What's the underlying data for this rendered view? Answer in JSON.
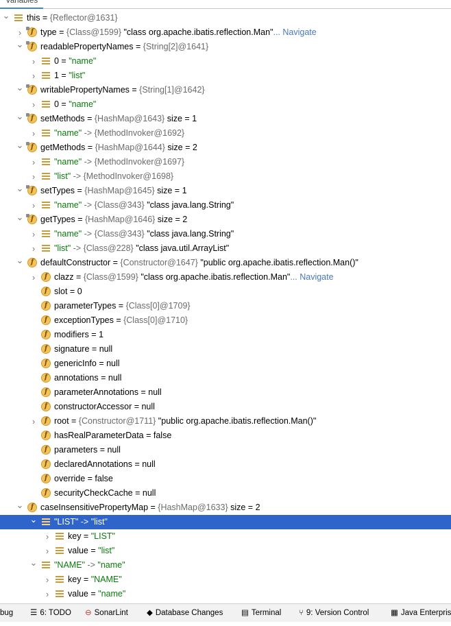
{
  "header": {
    "tab": "Variables"
  },
  "tree": [
    {
      "indent": 0,
      "expander": "down",
      "icon": "list",
      "name": "this",
      "value": "{Reflector@1631}",
      "extra": "",
      "link": "",
      "selected": false
    },
    {
      "indent": 1,
      "expander": "right",
      "icon": "field-static",
      "name": "type",
      "value": "{Class@1599}",
      "extra": "\"class org.apache.ibatis.reflection.Man\"",
      "link": "... Navigate",
      "selected": false
    },
    {
      "indent": 1,
      "expander": "down",
      "icon": "field-static",
      "name": "readablePropertyNames",
      "value": "{String[2]@1641}",
      "extra": "",
      "link": "",
      "selected": false
    },
    {
      "indent": 2,
      "expander": "right",
      "icon": "list",
      "name": "0",
      "value": "\"name\"",
      "extra": "",
      "link": "",
      "selected": false
    },
    {
      "indent": 2,
      "expander": "right",
      "icon": "list",
      "name": "1",
      "value": "\"list\"",
      "extra": "",
      "link": "",
      "selected": false
    },
    {
      "indent": 1,
      "expander": "down",
      "icon": "field-static",
      "name": "writablePropertyNames",
      "value": "{String[1]@1642}",
      "extra": "",
      "link": "",
      "selected": false
    },
    {
      "indent": 2,
      "expander": "right",
      "icon": "list",
      "name": "0",
      "value": "\"name\"",
      "extra": "",
      "link": "",
      "selected": false
    },
    {
      "indent": 1,
      "expander": "down",
      "icon": "field-static",
      "name": "setMethods",
      "value": "{HashMap@1643}",
      "extra": " size = 1",
      "link": "",
      "selected": false
    },
    {
      "indent": 2,
      "expander": "right",
      "icon": "list",
      "name": "\"name\"",
      "value": "-> {MethodInvoker@1692}",
      "extra": "",
      "link": "",
      "selected": false
    },
    {
      "indent": 1,
      "expander": "down",
      "icon": "field-static",
      "name": "getMethods",
      "value": "{HashMap@1644}",
      "extra": " size = 2",
      "link": "",
      "selected": false
    },
    {
      "indent": 2,
      "expander": "right",
      "icon": "list",
      "name": "\"name\"",
      "value": "-> {MethodInvoker@1697}",
      "extra": "",
      "link": "",
      "selected": false
    },
    {
      "indent": 2,
      "expander": "right",
      "icon": "list",
      "name": "\"list\"",
      "value": "-> {MethodInvoker@1698}",
      "extra": "",
      "link": "",
      "selected": false
    },
    {
      "indent": 1,
      "expander": "down",
      "icon": "field-static",
      "name": "setTypes",
      "value": "{HashMap@1645}",
      "extra": " size = 1",
      "link": "",
      "selected": false
    },
    {
      "indent": 2,
      "expander": "right",
      "icon": "list",
      "name": "\"name\"",
      "value": "-> {Class@343}",
      "extra": "\"class java.lang.String\"",
      "link": "",
      "selected": false
    },
    {
      "indent": 1,
      "expander": "down",
      "icon": "field-static",
      "name": "getTypes",
      "value": "{HashMap@1646}",
      "extra": " size = 2",
      "link": "",
      "selected": false
    },
    {
      "indent": 2,
      "expander": "right",
      "icon": "list",
      "name": "\"name\"",
      "value": "-> {Class@343}",
      "extra": "\"class java.lang.String\"",
      "link": "",
      "selected": false
    },
    {
      "indent": 2,
      "expander": "right",
      "icon": "list",
      "name": "\"list\"",
      "value": "-> {Class@228}",
      "extra": "\"class java.util.ArrayList\"",
      "link": "",
      "selected": false
    },
    {
      "indent": 1,
      "expander": "down",
      "icon": "field",
      "name": "defaultConstructor",
      "value": "{Constructor@1647}",
      "extra": "\"public org.apache.ibatis.reflection.Man()\"",
      "link": "",
      "selected": false
    },
    {
      "indent": 2,
      "expander": "right",
      "icon": "field",
      "name": "clazz",
      "value": "{Class@1599}",
      "extra": "\"class org.apache.ibatis.reflection.Man\"",
      "link": "... Navigate",
      "selected": false
    },
    {
      "indent": 2,
      "expander": "none",
      "icon": "field",
      "name": "slot",
      "value": "0",
      "extra": "",
      "link": "",
      "selected": false
    },
    {
      "indent": 2,
      "expander": "none",
      "icon": "field",
      "name": "parameterTypes",
      "value": "{Class[0]@1709}",
      "extra": "",
      "link": "",
      "selected": false
    },
    {
      "indent": 2,
      "expander": "none",
      "icon": "field",
      "name": "exceptionTypes",
      "value": "{Class[0]@1710}",
      "extra": "",
      "link": "",
      "selected": false
    },
    {
      "indent": 2,
      "expander": "none",
      "icon": "field",
      "name": "modifiers",
      "value": "1",
      "extra": "",
      "link": "",
      "selected": false
    },
    {
      "indent": 2,
      "expander": "none",
      "icon": "field",
      "name": "signature",
      "value": "null",
      "extra": "",
      "link": "",
      "selected": false
    },
    {
      "indent": 2,
      "expander": "none",
      "icon": "field",
      "name": "genericInfo",
      "value": "null",
      "extra": "",
      "link": "",
      "selected": false
    },
    {
      "indent": 2,
      "expander": "none",
      "icon": "field",
      "name": "annotations",
      "value": "null",
      "extra": "",
      "link": "",
      "selected": false
    },
    {
      "indent": 2,
      "expander": "none",
      "icon": "field",
      "name": "parameterAnnotations",
      "value": "null",
      "extra": "",
      "link": "",
      "selected": false
    },
    {
      "indent": 2,
      "expander": "none",
      "icon": "field",
      "name": "constructorAccessor",
      "value": "null",
      "extra": "",
      "link": "",
      "selected": false
    },
    {
      "indent": 2,
      "expander": "right",
      "icon": "field",
      "name": "root",
      "value": "{Constructor@1711}",
      "extra": "\"public org.apache.ibatis.reflection.Man()\"",
      "link": "",
      "selected": false
    },
    {
      "indent": 2,
      "expander": "none",
      "icon": "field",
      "name": "hasRealParameterData",
      "value": "false",
      "extra": "",
      "link": "",
      "selected": false
    },
    {
      "indent": 2,
      "expander": "none",
      "icon": "field",
      "name": "parameters",
      "value": "null",
      "extra": "",
      "link": "",
      "selected": false
    },
    {
      "indent": 2,
      "expander": "none",
      "icon": "field",
      "name": "declaredAnnotations",
      "value": "null",
      "extra": "",
      "link": "",
      "selected": false
    },
    {
      "indent": 2,
      "expander": "none",
      "icon": "field",
      "name": "override",
      "value": "false",
      "extra": "",
      "link": "",
      "selected": false
    },
    {
      "indent": 2,
      "expander": "none",
      "icon": "field",
      "name": "securityCheckCache",
      "value": "null",
      "extra": "",
      "link": "",
      "selected": false
    },
    {
      "indent": 1,
      "expander": "down",
      "icon": "field",
      "name": "caseInsensitivePropertyMap",
      "value": "{HashMap@1633}",
      "extra": " size = 2",
      "link": "",
      "selected": false
    },
    {
      "indent": 2,
      "expander": "down",
      "icon": "list",
      "name": "\"LIST\"",
      "value": "-> \"list\"",
      "extra": "",
      "link": "",
      "selected": true
    },
    {
      "indent": 3,
      "expander": "right",
      "icon": "list",
      "name": "key",
      "value": "\"LIST\"",
      "extra": "",
      "link": "",
      "selected": false
    },
    {
      "indent": 3,
      "expander": "right",
      "icon": "list",
      "name": "value",
      "value": "\"list\"",
      "extra": "",
      "link": "",
      "selected": false
    },
    {
      "indent": 2,
      "expander": "down",
      "icon": "list",
      "name": "\"NAME\"",
      "value": "-> \"name\"",
      "extra": "",
      "link": "",
      "selected": false
    },
    {
      "indent": 3,
      "expander": "right",
      "icon": "list",
      "name": "key",
      "value": "\"NAME\"",
      "extra": "",
      "link": "",
      "selected": false
    },
    {
      "indent": 3,
      "expander": "right",
      "icon": "list",
      "name": "value",
      "value": "\"name\"",
      "extra": "",
      "link": "",
      "selected": false
    }
  ],
  "bottombar": {
    "tabs": [
      {
        "label": "bug",
        "icon": "none"
      },
      {
        "label": "6: TODO",
        "icon": "todo-icon"
      },
      {
        "label": "SonarLint",
        "icon": "sonarlint-icon"
      },
      {
        "label": "Database Changes",
        "icon": "database-changes-icon"
      },
      {
        "label": "Terminal",
        "icon": "terminal-icon"
      },
      {
        "label": "9: Version Control",
        "icon": "version-control-icon"
      },
      {
        "label": "Java Enterpris",
        "icon": "java-enterprise-icon"
      }
    ]
  },
  "colors": {
    "selection": "#2f65ca",
    "string": "#0a7a0a",
    "link": "#4a78b9",
    "gray": "#6b6b6b",
    "field_icon": "#f3c35e"
  }
}
